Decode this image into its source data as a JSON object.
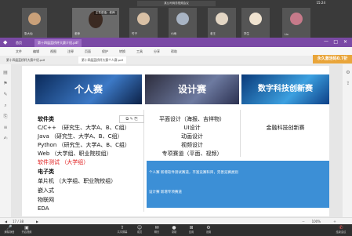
{
  "meeting": {
    "title": "某公司商务视频会议",
    "clock": "15:24",
    "presenter_label": "正在讲话：老师",
    "tiles": [
      {
        "name": "张大仙"
      },
      {
        "name": "老师"
      },
      {
        "name": "竹子"
      },
      {
        "name": "小雨"
      },
      {
        "name": "老王"
      },
      {
        "name": "学生"
      },
      {
        "name": "Lin"
      }
    ]
  },
  "app": {
    "tabs": [
      "首页",
      "第十四届蓝桥杯大赛介绍.pdf"
    ],
    "menu": [
      "文件",
      "编辑",
      "视图",
      "注释",
      "页面",
      "保护",
      "转换",
      "工具",
      "分享",
      "帮助"
    ],
    "doc_tabs": [
      "第十四届蓝桥杯大赛介绍.pdf",
      "第十四届蓝桥杯大赛个人赛.pdf"
    ],
    "badge": "永久激活码0.7折"
  },
  "slide": {
    "banners": [
      "个人赛",
      "设计赛",
      "数字科技创新赛"
    ],
    "software_title": "软件类",
    "software_items": [
      "C/C++  （研究生、大学A、B、C组）",
      "Java   （研究生、大学A、B、C组）",
      "Python （研究生、大学A、B、C组）",
      "Web   （大学组、职业院校组）"
    ],
    "software_test": "软件测试 （大学组）",
    "electronic_title": "电子类",
    "electronic_items": [
      "单片机 （大学组、职业院校组）",
      "嵌入式",
      "物联网",
      "EDA"
    ],
    "design_items": [
      "平面设计（海报、吉祥物）",
      "UI设计",
      "动画设计",
      "视频设计"
    ],
    "design_special": "专项赛道（平面、视频）",
    "digital_item": "金融科技创新赛",
    "blue_lines": [
      "个人赛   新增软件测试赛道，丰富竞赛科目，完善竞赛类别",
      "设计赛   新增专项赛道"
    ]
  },
  "status": {
    "page_display": "17 / 38",
    "zoom": "100%"
  },
  "meetbar": [
    {
      "icon": "mic-icon",
      "label": "解除静音"
    },
    {
      "icon": "camera-icon",
      "label": "开启视频"
    },
    {
      "icon": "share-icon",
      "label": "共享屏幕"
    },
    {
      "icon": "people-icon",
      "label": "成员"
    },
    {
      "icon": "chat-icon",
      "label": "聊天"
    },
    {
      "icon": "record-icon",
      "label": "录制"
    },
    {
      "icon": "app-icon",
      "label": "应用"
    },
    {
      "icon": "settings-icon",
      "label": "设置"
    },
    {
      "icon": "end-icon",
      "label": "结束会议"
    }
  ]
}
